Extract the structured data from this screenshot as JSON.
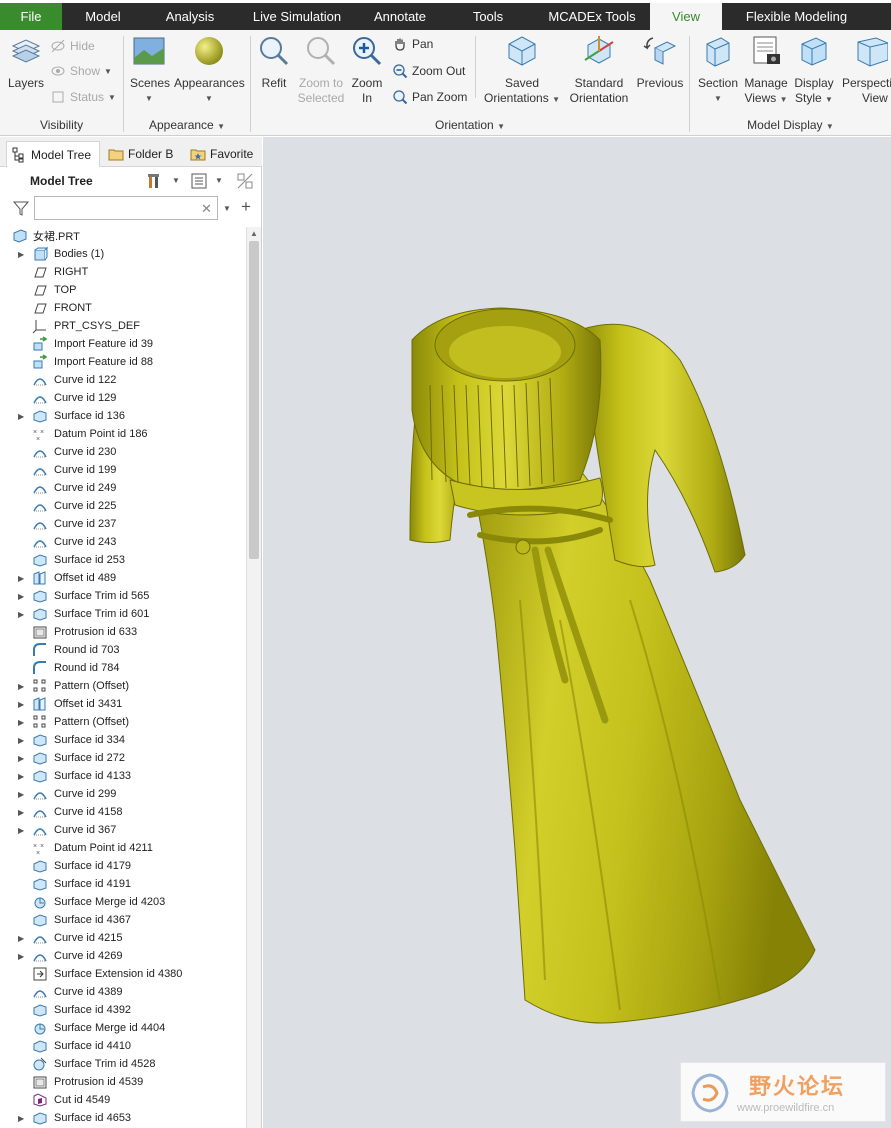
{
  "tabs": [
    "File",
    "Model",
    "Analysis",
    "Live Simulation",
    "Annotate",
    "Tools",
    "MCADEx Tools",
    "View",
    "Flexible Modeling"
  ],
  "active_tab": "View",
  "ribbon": {
    "visibility": {
      "layers": "Layers",
      "hide": "Hide",
      "show": "Show",
      "status": "Status",
      "label": "Visibility"
    },
    "appearance": {
      "scenes": "Scenes",
      "appearances": "Appearances",
      "label": "Appearance"
    },
    "orientation": {
      "refit": "Refit",
      "zoom_to_selected_1": "Zoom to",
      "zoom_to_selected_2": "Selected",
      "zoom_in_1": "Zoom",
      "zoom_in_2": "In",
      "pan": "Pan",
      "zoom_out": "Zoom Out",
      "pan_zoom": "Pan Zoom",
      "saved_1": "Saved",
      "saved_2": "Orientations",
      "standard_1": "Standard",
      "standard_2": "Orientation",
      "previous": "Previous",
      "label": "Orientation"
    },
    "model_display": {
      "section": "Section",
      "manage_1": "Manage",
      "manage_2": "Views",
      "display_1": "Display",
      "display_2": "Style",
      "perspective_1": "Perspective",
      "perspective_2": "View",
      "label": "Model Display"
    }
  },
  "panel": {
    "tabs": [
      "Model Tree",
      "Folder B",
      "Favorite"
    ],
    "title": "Model Tree",
    "search_value": ""
  },
  "tree": {
    "root": "女裙.PRT",
    "items": [
      {
        "label": "Bodies (1)",
        "icon": "bodies-icon",
        "expandable": true
      },
      {
        "label": "RIGHT",
        "icon": "datum-plane-icon",
        "expandable": false
      },
      {
        "label": "TOP",
        "icon": "datum-plane-icon",
        "expandable": false
      },
      {
        "label": "FRONT",
        "icon": "datum-plane-icon",
        "expandable": false
      },
      {
        "label": "PRT_CSYS_DEF",
        "icon": "csys-icon",
        "expandable": false
      },
      {
        "label": "Import Feature id 39",
        "icon": "import-feature-icon",
        "expandable": false
      },
      {
        "label": "Import Feature id 88",
        "icon": "import-feature-icon",
        "expandable": false
      },
      {
        "label": "Curve id 122",
        "icon": "curve-icon",
        "expandable": false
      },
      {
        "label": "Curve id 129",
        "icon": "curve-icon",
        "expandable": false
      },
      {
        "label": "Surface id 136",
        "icon": "surface-icon",
        "expandable": true
      },
      {
        "label": "Datum Point id 186",
        "icon": "datum-point-icon",
        "expandable": false
      },
      {
        "label": "Curve id 230",
        "icon": "curve-icon",
        "expandable": false
      },
      {
        "label": "Curve id 199",
        "icon": "curve-icon",
        "expandable": false
      },
      {
        "label": "Curve id 249",
        "icon": "curve-icon",
        "expandable": false
      },
      {
        "label": "Curve id 225",
        "icon": "curve-icon",
        "expandable": false
      },
      {
        "label": "Curve id 237",
        "icon": "curve-icon",
        "expandable": false
      },
      {
        "label": "Curve id 243",
        "icon": "curve-icon",
        "expandable": false
      },
      {
        "label": "Surface id 253",
        "icon": "surface-icon",
        "expandable": false
      },
      {
        "label": "Offset id 489",
        "icon": "offset-icon",
        "expandable": true
      },
      {
        "label": "Surface Trim id 565",
        "icon": "surface-icon",
        "expandable": true
      },
      {
        "label": "Surface Trim id 601",
        "icon": "surface-icon",
        "expandable": true
      },
      {
        "label": "Protrusion id 633",
        "icon": "protrusion-icon",
        "expandable": false
      },
      {
        "label": "Round id 703",
        "icon": "round-icon",
        "expandable": false
      },
      {
        "label": "Round id 784",
        "icon": "round-icon",
        "expandable": false
      },
      {
        "label": "Pattern (Offset)",
        "icon": "pattern-icon",
        "expandable": true
      },
      {
        "label": "Offset id 3431",
        "icon": "offset-icon",
        "expandable": true
      },
      {
        "label": "Pattern (Offset)",
        "icon": "pattern-icon",
        "expandable": true
      },
      {
        "label": "Surface id 334",
        "icon": "surface-icon",
        "expandable": true
      },
      {
        "label": "Surface id 272",
        "icon": "surface-icon",
        "expandable": true
      },
      {
        "label": "Surface id 4133",
        "icon": "surface-icon",
        "expandable": true
      },
      {
        "label": "Curve id 299",
        "icon": "curve-icon",
        "expandable": true
      },
      {
        "label": "Curve id 4158",
        "icon": "curve-icon",
        "expandable": true
      },
      {
        "label": "Curve id 367",
        "icon": "curve-icon",
        "expandable": true
      },
      {
        "label": "Datum Point id 4211",
        "icon": "datum-point-icon",
        "expandable": false
      },
      {
        "label": "Surface id 4179",
        "icon": "surface-icon",
        "expandable": false
      },
      {
        "label": "Surface id 4191",
        "icon": "surface-icon",
        "expandable": false
      },
      {
        "label": "Surface Merge id 4203",
        "icon": "merge-icon",
        "expandable": false
      },
      {
        "label": "Surface id 4367",
        "icon": "surface-icon",
        "expandable": false
      },
      {
        "label": "Curve id 4215",
        "icon": "curve-icon",
        "expandable": true
      },
      {
        "label": "Curve id 4269",
        "icon": "curve-icon",
        "expandable": true
      },
      {
        "label": "Surface Extension id 4380",
        "icon": "extension-icon",
        "expandable": false
      },
      {
        "label": "Curve id 4389",
        "icon": "curve-icon",
        "expandable": false
      },
      {
        "label": "Surface id 4392",
        "icon": "surface-icon",
        "expandable": false
      },
      {
        "label": "Surface Merge id 4404",
        "icon": "merge-icon",
        "expandable": false
      },
      {
        "label": "Surface id 4410",
        "icon": "surface-icon",
        "expandable": false
      },
      {
        "label": "Surface Trim id 4528",
        "icon": "trim-icon",
        "expandable": false
      },
      {
        "label": "Protrusion id 4539",
        "icon": "protrusion-icon",
        "expandable": false
      },
      {
        "label": "Cut id 4549",
        "icon": "cut-icon",
        "expandable": false
      },
      {
        "label": "Surface id 4653",
        "icon": "surface-icon",
        "expandable": true
      }
    ]
  },
  "colors": {
    "accent": "#3a8a2e",
    "model": "#c8c41a",
    "viewport_bg": "#dcdfe3"
  },
  "watermark": {
    "text_cn": "野火论坛",
    "url": "www.proewildfire.cn"
  }
}
